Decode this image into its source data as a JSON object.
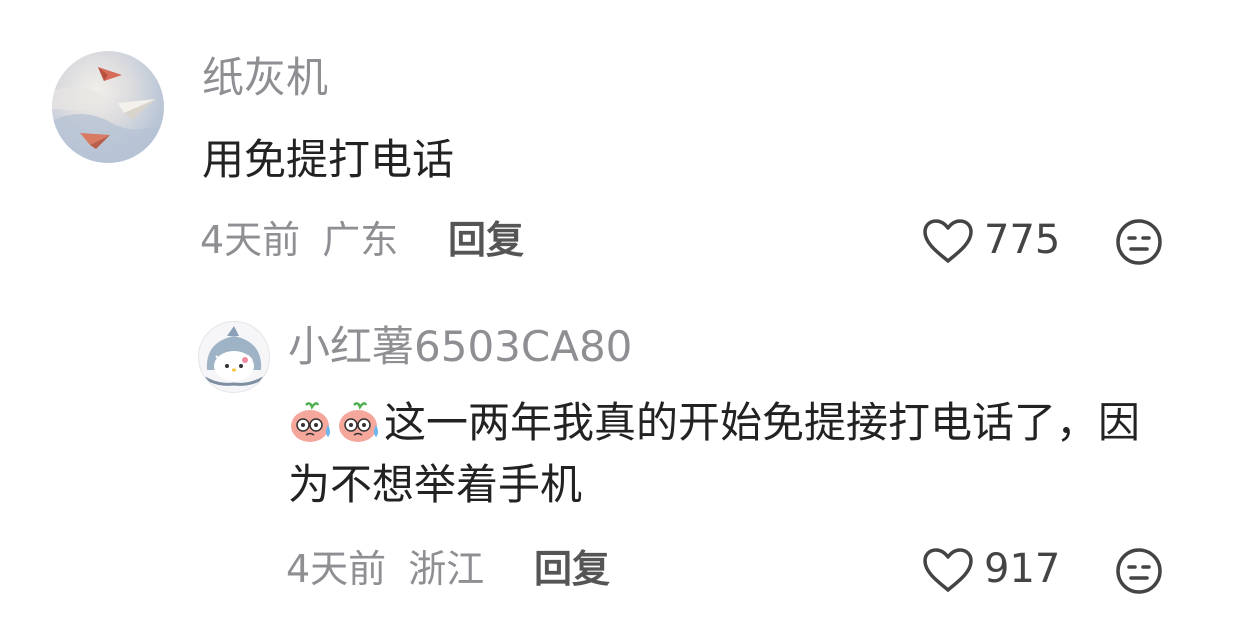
{
  "comments": [
    {
      "username": "纸灰机",
      "text": "用免提打电话",
      "time": "4天前",
      "location": "广东",
      "reply_label": "回复",
      "likes": "775",
      "avatar_icon": "paper-plane-avatar",
      "dislike_icon": "dislike-face-icon"
    }
  ],
  "reply": {
    "username": "小红薯6503CA80",
    "emoji_stickers": [
      "sweat-peach-emoji",
      "sweat-peach-emoji"
    ],
    "text": "这一两年我真的开始免提接打电话了，因为不想举着手机",
    "time": "4天前",
    "location": "浙江",
    "reply_label": "回复",
    "likes": "917",
    "avatar_icon": "shark-kitty-avatar",
    "dislike_icon": "dislike-face-icon"
  },
  "colors": {
    "meta_gray": "#8e8e93",
    "text_dark": "#222222",
    "reply_dark": "#555555"
  }
}
